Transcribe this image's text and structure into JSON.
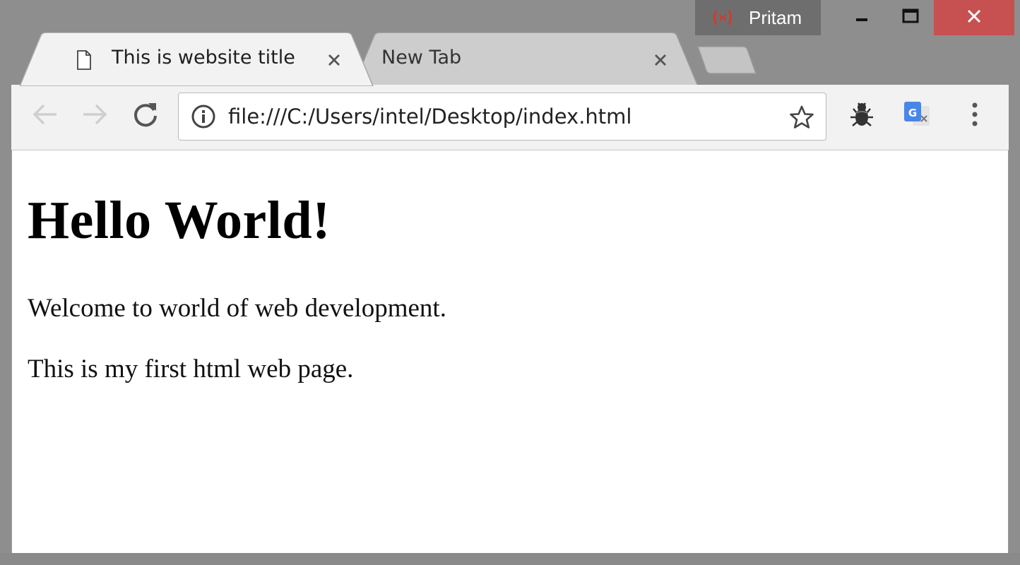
{
  "profile": {
    "name": "Pritam",
    "icon": "profile-incognito-icon"
  },
  "window_controls": {
    "minimize_icon": "minimize-icon",
    "maximize_icon": "maximize-icon",
    "close_icon": "close-icon",
    "close_color": "#c75050"
  },
  "tabs": [
    {
      "title": "This is website title",
      "active": true,
      "icon": "document-icon"
    },
    {
      "title": "New Tab",
      "active": false
    }
  ],
  "toolbar": {
    "back_icon": "back-arrow-icon",
    "forward_icon": "forward-arrow-icon",
    "reload_icon": "reload-icon",
    "address": "file:///C:/Users/intel/Desktop/index.html",
    "info_icon": "info-icon",
    "bookmark_icon": "star-icon",
    "extensions": [
      "bug-extension-icon",
      "google-translate-icon"
    ],
    "menu_icon": "menu-dots-icon"
  },
  "page": {
    "heading": "Hello World!",
    "paragraphs": [
      "Welcome to world of web development.",
      "This is my first html web page."
    ]
  }
}
